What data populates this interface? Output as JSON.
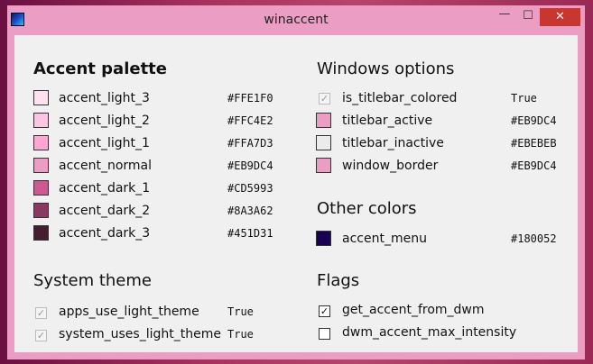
{
  "window": {
    "title": "winaccent",
    "controls": {
      "minimize": "—",
      "maximize": "☐",
      "close": "✕"
    }
  },
  "accent_palette": {
    "heading": "Accent palette",
    "items": [
      {
        "name": "accent_light_3",
        "hex": "#FFE1F0",
        "color": "#FFE1F0"
      },
      {
        "name": "accent_light_2",
        "hex": "#FFC4E2",
        "color": "#FFC4E2"
      },
      {
        "name": "accent_light_1",
        "hex": "#FFA7D3",
        "color": "#FFA7D3"
      },
      {
        "name": "accent_normal",
        "hex": "#EB9DC4",
        "color": "#EB9DC4"
      },
      {
        "name": "accent_dark_1",
        "hex": "#CD5993",
        "color": "#CD5993"
      },
      {
        "name": "accent_dark_2",
        "hex": "#8A3A62",
        "color": "#8A3A62"
      },
      {
        "name": "accent_dark_3",
        "hex": "#451D31",
        "color": "#451D31"
      }
    ]
  },
  "windows_options": {
    "heading": "Windows options",
    "is_titlebar_colored": {
      "label": "is_titlebar_colored",
      "value": "True",
      "checked": true
    },
    "items": [
      {
        "name": "titlebar_active",
        "hex": "#EB9DC4",
        "color": "#EB9DC4"
      },
      {
        "name": "titlebar_inactive",
        "hex": "#EBEBEB",
        "color": "#EBEBEB"
      },
      {
        "name": "window_border",
        "hex": "#EB9DC4",
        "color": "#EB9DC4"
      }
    ]
  },
  "other_colors": {
    "heading": "Other colors",
    "items": [
      {
        "name": "accent_menu",
        "hex": "#180052",
        "color": "#180052"
      }
    ]
  },
  "system_theme": {
    "heading": "System theme",
    "items": [
      {
        "label": "apps_use_light_theme",
        "value": "True",
        "checked": true
      },
      {
        "label": "system_uses_light_theme",
        "value": "True",
        "checked": true
      }
    ]
  },
  "flags": {
    "heading": "Flags",
    "items": [
      {
        "label": "get_accent_from_dwm",
        "checked": true
      },
      {
        "label": "dwm_accent_max_intensity",
        "checked": false
      }
    ]
  },
  "glyphs": {
    "check": "✓"
  }
}
